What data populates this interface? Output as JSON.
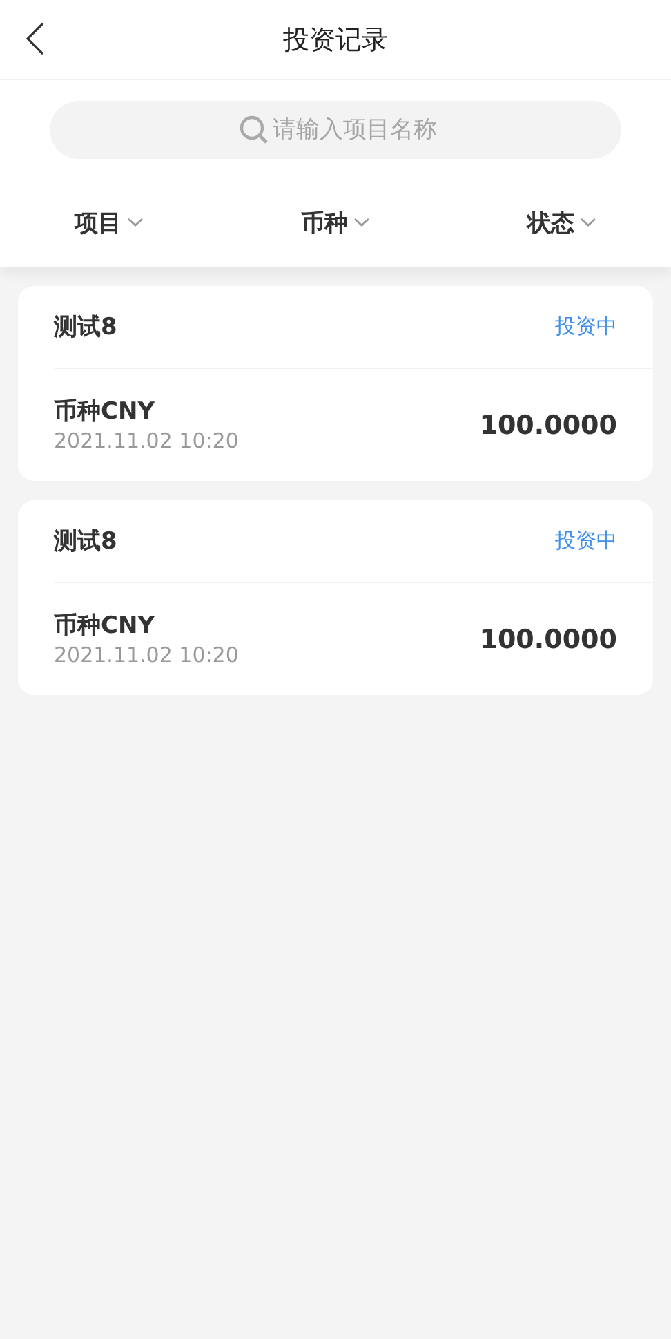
{
  "header": {
    "title": "投资记录"
  },
  "search": {
    "placeholder": "请输入项目名称"
  },
  "filters": [
    {
      "label": "项目"
    },
    {
      "label": "币种"
    },
    {
      "label": "状态"
    }
  ],
  "records": [
    {
      "project": "测试8",
      "status": "投资中",
      "currency": "币种CNY",
      "time": "2021.11.02 10:20",
      "amount": "100.0000"
    },
    {
      "project": "测试8",
      "status": "投资中",
      "currency": "币种CNY",
      "time": "2021.11.02 10:20",
      "amount": "100.0000"
    }
  ]
}
